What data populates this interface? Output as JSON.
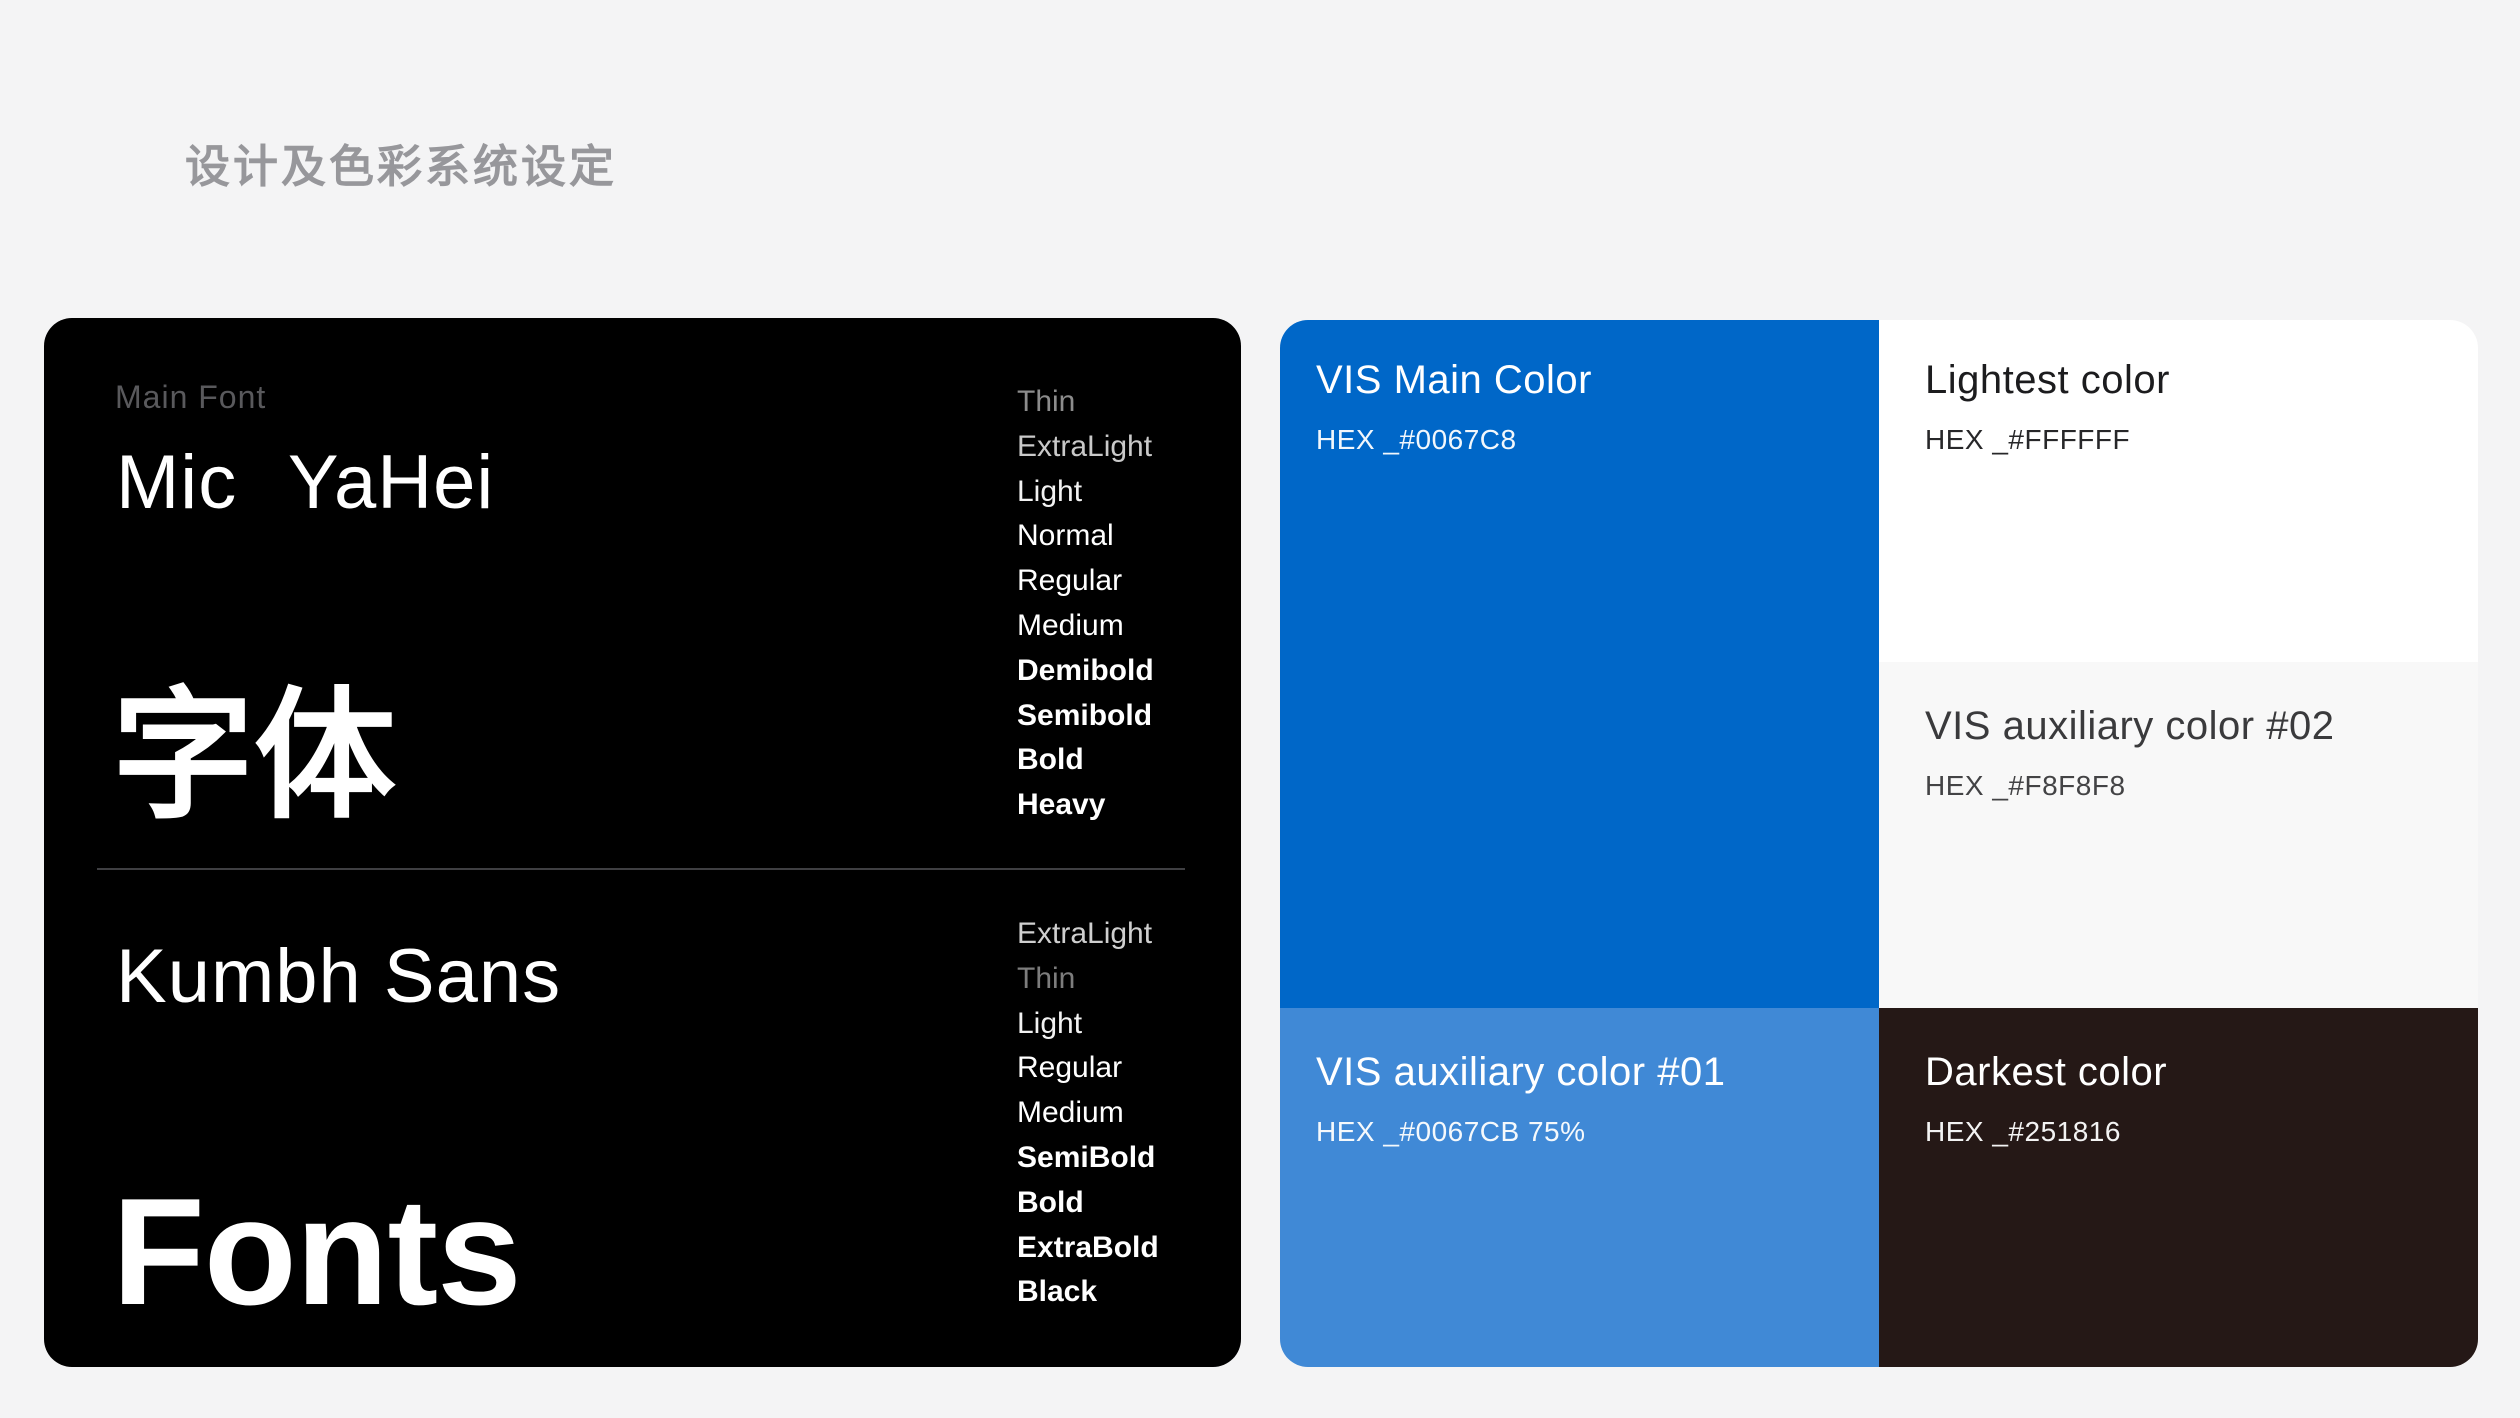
{
  "page": {
    "title": "设计及色彩系统设定",
    "background_color": "#F4F4F5"
  },
  "font_panel": {
    "background_color": "#000000",
    "section_label": "Main Font",
    "divider_color": "#3F3F42",
    "font1": {
      "name": "Mic YaHei",
      "specimen": "字体",
      "weights": [
        {
          "label": "Thin",
          "weight": 100,
          "color": "#8C8C8C"
        },
        {
          "label": "ExtraLight",
          "weight": 200,
          "color": "#C9C9C9"
        },
        {
          "label": "Light",
          "weight": 300,
          "color": "#F2F2F2"
        },
        {
          "label": "Normal",
          "weight": 400,
          "color": "#FFFFFF"
        },
        {
          "label": "Regular",
          "weight": 400,
          "color": "#FFFFFF"
        },
        {
          "label": "Medium",
          "weight": 500,
          "color": "#FFFFFF"
        },
        {
          "label": "Demibold",
          "weight": 600,
          "color": "#FFFFFF"
        },
        {
          "label": "Semibold",
          "weight": 700,
          "color": "#FFFFFF"
        },
        {
          "label": "Bold",
          "weight": 700,
          "color": "#FFFFFF"
        },
        {
          "label": "Heavy",
          "weight": 800,
          "color": "#FFFFFF"
        }
      ]
    },
    "font2": {
      "name": "Kumbh Sans",
      "specimen": "Fonts",
      "weights": [
        {
          "label": "ExtraLight",
          "weight": 200,
          "color": "#CFCFCF"
        },
        {
          "label": "Thin",
          "weight": 100,
          "color": "#7D7D7D"
        },
        {
          "label": "Light",
          "weight": 300,
          "color": "#F2F2F2"
        },
        {
          "label": "Regular",
          "weight": 400,
          "color": "#FFFFFF"
        },
        {
          "label": "Medium",
          "weight": 500,
          "color": "#FFFFFF"
        },
        {
          "label": "SemiBold",
          "weight": 600,
          "color": "#FFFFFF"
        },
        {
          "label": "Bold",
          "weight": 700,
          "color": "#FFFFFF"
        },
        {
          "label": "ExtraBold",
          "weight": 800,
          "color": "#FFFFFF"
        },
        {
          "label": "Black",
          "weight": 900,
          "color": "#FFFFFF"
        }
      ]
    }
  },
  "color_panel": {
    "swatches": [
      {
        "title": "VIS Main Color",
        "hex_label": "HEX _#0067C8",
        "color": "#0067C8",
        "text_color": "#FFFFFF"
      },
      {
        "title": "Lightest color",
        "hex_label": "HEX _#FFFFFF",
        "color": "#FFFFFF",
        "text_color": "#1C1C1E"
      },
      {
        "title": "VIS auxiliary color #02",
        "hex_label": "HEX _#F8F8F8",
        "color": "#F8F8F8",
        "text_color": "#3A3A3C"
      },
      {
        "title": "VIS auxiliary color #01",
        "hex_label": "HEX _#0067CB 75%",
        "color": "#4089D6",
        "text_color": "#FFFFFF"
      },
      {
        "title": "Darkest color",
        "hex_label": "HEX _#251816",
        "color": "#251816",
        "text_color": "#FFFFFF"
      }
    ]
  }
}
